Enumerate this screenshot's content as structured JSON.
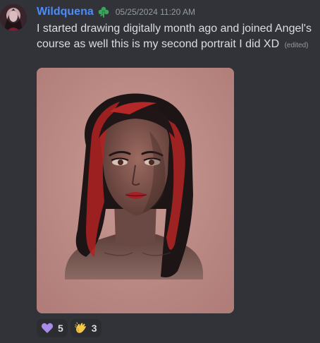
{
  "message": {
    "username": "Wildquena",
    "timestamp": "05/25/2024 11:20 AM",
    "text": "I started drawing digitally month ago and joined Angel's course as well this is my second portrait I did XD",
    "edited_label": "(edited)",
    "role_icon": "green-leaf-icon",
    "attachment": {
      "kind": "image",
      "subject": "digital painted portrait"
    },
    "reactions": [
      {
        "emoji": "purple-heart-icon",
        "count": "5"
      },
      {
        "emoji": "clapping-hands-icon",
        "count": "3"
      }
    ]
  },
  "colors": {
    "background": "#313338",
    "username": "#4d8cf5",
    "text": "#dbdee1",
    "muted": "#949ba4",
    "reaction_bg": "#2b2d31"
  }
}
